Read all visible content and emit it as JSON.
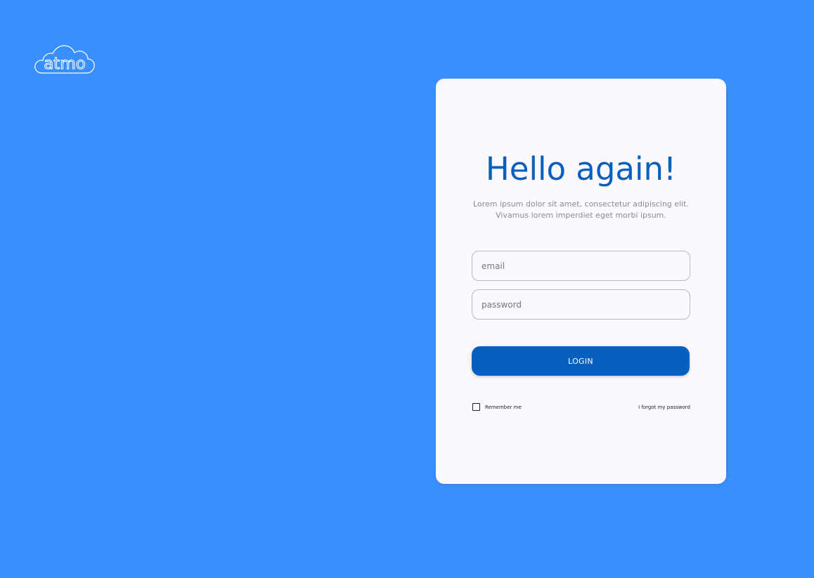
{
  "brand": {
    "logo_text": "atmo",
    "logo_icon": "cloud-logo"
  },
  "login": {
    "title": "Hello again!",
    "subtitle": "Lorem ipsum dolor sit amet, consectetur adipiscing elit. Vivamus lorem imperdiet eget morbi ipsum.",
    "email": {
      "value": "",
      "placeholder": "email"
    },
    "password": {
      "value": "",
      "placeholder": "password"
    },
    "login_button_label": "LOGIN",
    "remember_me_label": "Remember me",
    "remember_me_checked": false,
    "forgot_password_label": "I forgot my password"
  },
  "colors": {
    "background": "#3a8fff",
    "card": "#fbf9fd",
    "accent": "#075fbe",
    "subtitle_text": "#8b8b96",
    "field_border": "#b9b6c4"
  }
}
